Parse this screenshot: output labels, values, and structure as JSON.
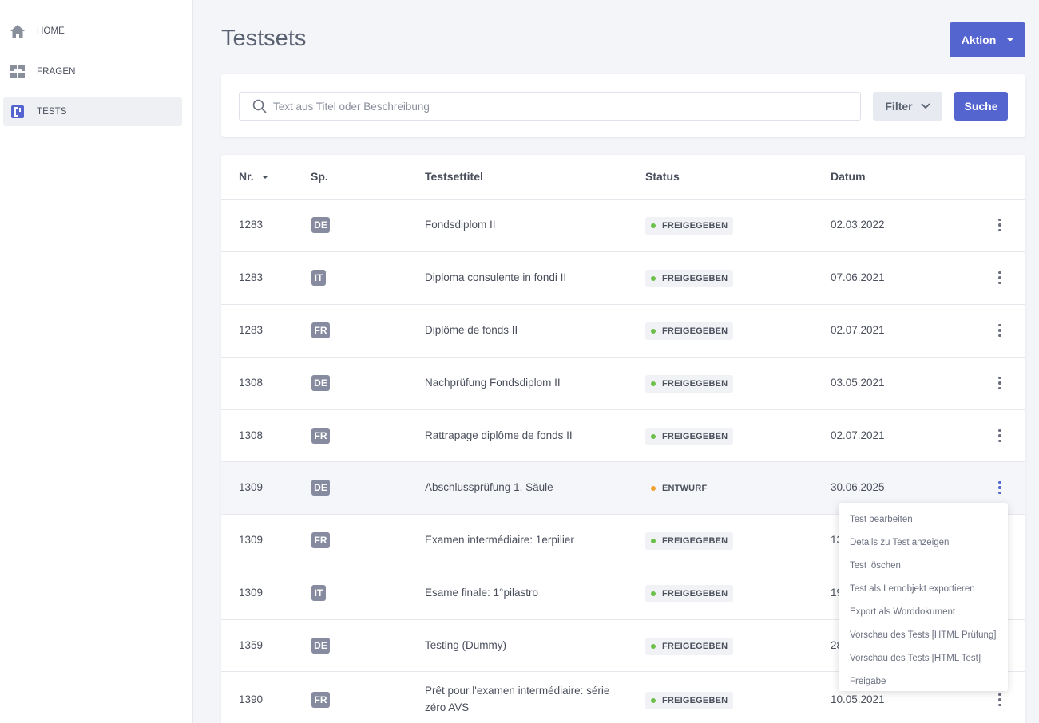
{
  "sidebar": {
    "items": [
      {
        "label": "HOME",
        "icon": "home-icon"
      },
      {
        "label": "FRAGEN",
        "icon": "questions-icon"
      },
      {
        "label": "TESTS",
        "icon": "tests-icon",
        "active": true
      }
    ]
  },
  "header": {
    "title": "Testsets",
    "action_label": "Aktion"
  },
  "search": {
    "placeholder": "Text aus Titel oder Beschreibung",
    "value": "",
    "filter_label": "Filter",
    "submit_label": "Suche"
  },
  "table": {
    "columns": {
      "nr": "Nr.",
      "lang": "Sp.",
      "title": "Testsettitel",
      "status": "Status",
      "date": "Datum"
    },
    "rows": [
      {
        "nr": "1283",
        "lang": "DE",
        "title": "Fondsdiplom II",
        "status": "FREIGEGEBEN",
        "date": "02.03.2022"
      },
      {
        "nr": "1283",
        "lang": "IT",
        "title": "Diploma consulente in fondi II",
        "status": "FREIGEGEBEN",
        "date": "07.06.2021"
      },
      {
        "nr": "1283",
        "lang": "FR",
        "title": "Diplôme de fonds II",
        "status": "FREIGEGEBEN",
        "date": "02.07.2021"
      },
      {
        "nr": "1308",
        "lang": "DE",
        "title": "Nachprüfung Fondsdiplom II",
        "status": "FREIGEGEBEN",
        "date": "03.05.2021"
      },
      {
        "nr": "1308",
        "lang": "FR",
        "title": "Rattrapage diplôme de fonds II",
        "status": "FREIGEGEBEN",
        "date": "02.07.2021"
      },
      {
        "nr": "1309",
        "lang": "DE",
        "title": "Abschlussprüfung 1. Säule",
        "status": "ENTWURF",
        "date": "30.06.2025"
      },
      {
        "nr": "1309",
        "lang": "FR",
        "title": "Examen intermédiaire: 1erpilier",
        "status": "FREIGEGEBEN",
        "date": "13"
      },
      {
        "nr": "1309",
        "lang": "IT",
        "title": "Esame finale: 1°pilastro",
        "status": "FREIGEGEBEN",
        "date": "19"
      },
      {
        "nr": "1359",
        "lang": "DE",
        "title": "Testing (Dummy)",
        "status": "FREIGEGEBEN",
        "date": "28"
      },
      {
        "nr": "1390",
        "lang": "FR",
        "title_line1": "Prêt pour l'examen intermédiaire: série",
        "title_line2": "zéro AVS",
        "status": "FREIGEGEBEN",
        "date": "10.05.2021"
      }
    ]
  },
  "row_menu": {
    "items": [
      "Test bearbeiten",
      "Details zu Test anzeigen",
      "Test löschen",
      "Test als Lernobjekt exportieren",
      "Export als Worddokument",
      "Vorschau des Tests [HTML Prüfung]",
      "Vorschau des Tests [HTML Test]",
      "Freigabe"
    ]
  },
  "colors": {
    "accent": "#5465cf",
    "status_released": "#6cc04a",
    "status_draft": "#f0a030",
    "lang_badge": "#868b9f"
  }
}
